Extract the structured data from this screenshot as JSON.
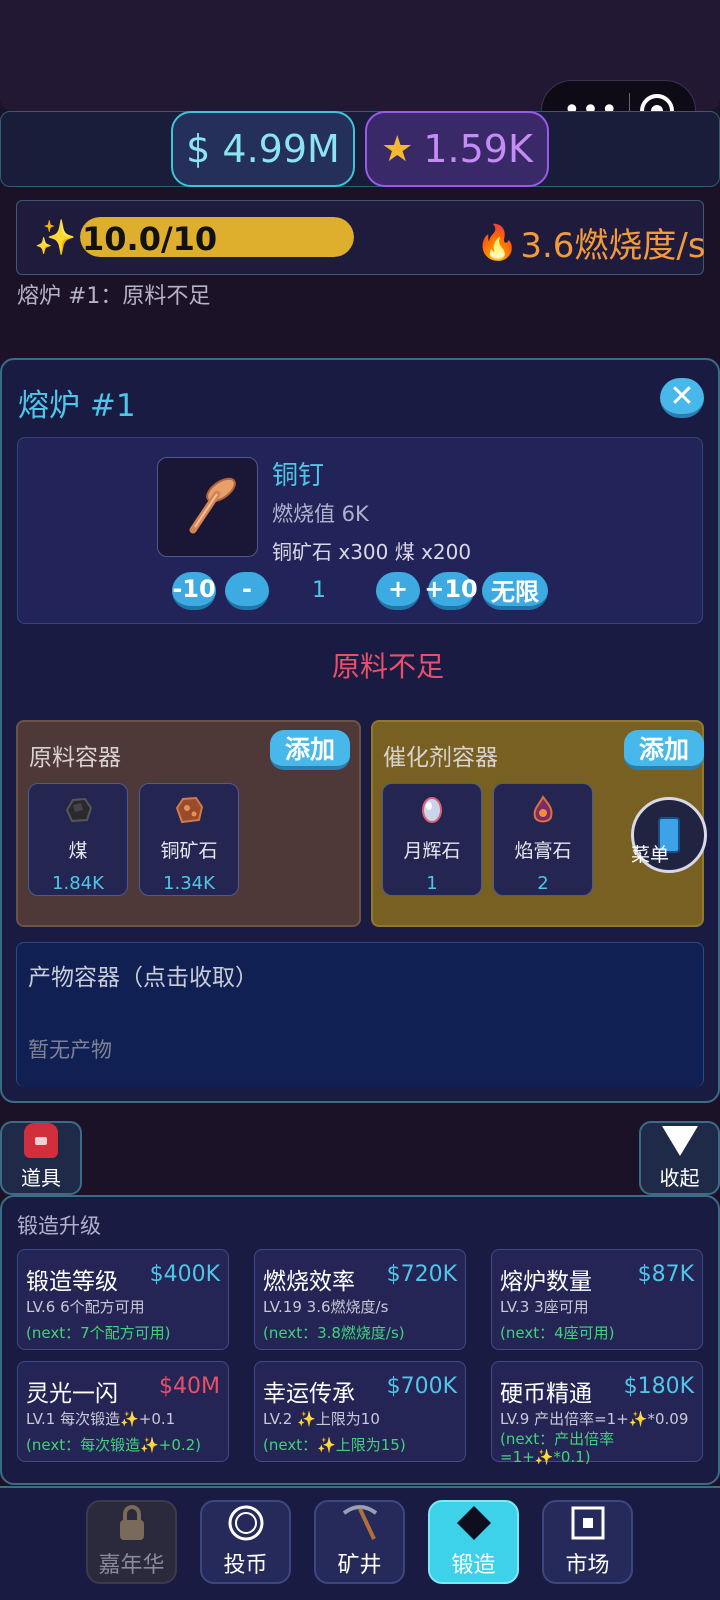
{
  "capsule": {
    "more_icon": "more-dots-icon",
    "target_icon": "target-icon"
  },
  "currency": {
    "money": "$ 4.99M",
    "star_icon": "star-icon",
    "stars": "1.59K"
  },
  "progress": {
    "icon": "sparkle-icon",
    "value_text": "10.0/10",
    "fill_fraction": 1.0,
    "burn_rate": "3.6燃烧度/s",
    "burn_icon": "flame-icon"
  },
  "furnace_status": "熔炉 #1：原料不足",
  "furnace": {
    "title": "熔炉 #1",
    "item": {
      "name": "铜钉",
      "burn_value": "燃烧值 6K",
      "cost": "铜矿石 x300  煤 x200"
    },
    "qty": {
      "minus10": "-10",
      "minus": "-",
      "value": "1",
      "plus": "+",
      "plus10": "+10",
      "unlimited": "无限"
    },
    "warning": "原料不足"
  },
  "raw_container": {
    "title": "原料容器",
    "add_label": "添加",
    "slots": [
      {
        "name": "煤",
        "count": "1.84K"
      },
      {
        "name": "铜矿石",
        "count": "1.34K"
      }
    ]
  },
  "catalyst_container": {
    "title": "催化剂容器",
    "add_label": "添加",
    "slots": [
      {
        "name": "月辉石",
        "count": "1"
      },
      {
        "name": "焰膏石",
        "count": "2"
      }
    ]
  },
  "menu_float": {
    "label": "菜单"
  },
  "product": {
    "title": "产物容器（点击收取）",
    "empty": "暂无产物"
  },
  "tools": {
    "label": "道具"
  },
  "collapse": {
    "label": "收起"
  },
  "upgrades": {
    "title": "锻造升级",
    "cards": [
      {
        "name": "锻造等级",
        "price": "$400K",
        "level": "LV.6 6个配方可用",
        "next": "(next：7个配方可用)"
      },
      {
        "name": "燃烧效率",
        "price": "$720K",
        "level": "LV.19 3.6燃烧度/s",
        "next": "(next：3.8燃烧度/s)"
      },
      {
        "name": "熔炉数量",
        "price": "$87K",
        "level": "LV.3 3座可用",
        "next": "(next：4座可用)"
      },
      {
        "name": "灵光一闪",
        "price": "$40M",
        "level": "LV.1 每次锻造✨+0.1",
        "next": "(next：每次锻造✨+0.2)"
      },
      {
        "name": "幸运传承",
        "price": "$700K",
        "level": "LV.2 ✨上限为10",
        "next": "(next：✨上限为15)"
      },
      {
        "name": "硬币精通",
        "price": "$180K",
        "level": "LV.9 产出倍率=1+✨*0.09",
        "next": "(next：产出倍率=1+✨*0.1)"
      }
    ]
  },
  "nav": [
    {
      "label": "嘉年华",
      "icon": "lock-icon"
    },
    {
      "label": "投币",
      "icon": "coin-icon"
    },
    {
      "label": "矿井",
      "icon": "pickaxe-icon"
    },
    {
      "label": "锻造",
      "icon": "diamond-icon"
    },
    {
      "label": "市场",
      "icon": "market-icon"
    }
  ],
  "colors": {
    "accent": "#4ec6e8",
    "warning": "#ea4f6a",
    "gold": "#deae2d",
    "forge_active": "#3ed2ea"
  }
}
